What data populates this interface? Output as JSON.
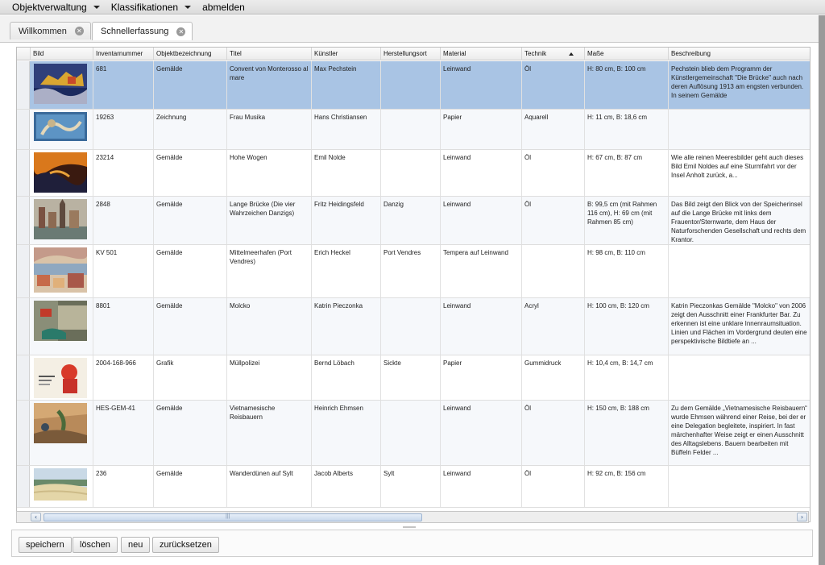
{
  "menu": {
    "items": [
      {
        "label": "Objektverwaltung",
        "has_dropdown": true
      },
      {
        "label": "Klassifikationen",
        "has_dropdown": true
      },
      {
        "label": "abmelden",
        "has_dropdown": false
      }
    ]
  },
  "tabs": [
    {
      "label": "Willkommen",
      "active": false
    },
    {
      "label": "Schnellerfassung",
      "active": true
    }
  ],
  "grid": {
    "columns": [
      "Bild",
      "Inventarnummer",
      "Objektbezeichnung",
      "Titel",
      "Künstler",
      "Herstellungsort",
      "Material",
      "Technik",
      "Maße",
      "Beschreibung"
    ],
    "sorted_column": "Technik",
    "sort_direction": "ascending",
    "rows": [
      {
        "inv": "681",
        "obj": "Gemälde",
        "titel": "Convent von Monterosso al mare",
        "kuenstler": "Max Pechstein",
        "ort": "",
        "material": "Leinwand",
        "technik": "Öl",
        "masse": "H: 80 cm, B: 100 cm",
        "beschreibung": "Pechstein blieb dem Programm der Künstlergemeinschaft \"Die Brücke\" auch nach deren Auflösung 1913 am engsten verbunden. In seinem Gemälde",
        "selected": true
      },
      {
        "inv": "19263",
        "obj": "Zeichnung",
        "titel": "Frau Musika",
        "kuenstler": "Hans Christiansen",
        "ort": "",
        "material": "Papier",
        "technik": "Aquarell",
        "masse": "H: 11 cm, B: 18,6 cm",
        "beschreibung": "",
        "selected": false
      },
      {
        "inv": "23214",
        "obj": "Gemälde",
        "titel": "Hohe Wogen",
        "kuenstler": "Emil Nolde",
        "ort": "",
        "material": "Leinwand",
        "technik": "Öl",
        "masse": "H: 67 cm, B: 87 cm",
        "beschreibung": "Wie alle reinen Meeresbilder geht auch dieses Bild Emil Noldes auf eine Sturmfahrt vor der Insel Anholt zurück, a...",
        "selected": false
      },
      {
        "inv": "2848",
        "obj": "Gemälde",
        "titel": "Lange Brücke (Die vier Wahrzeichen Danzigs)",
        "kuenstler": "Fritz Heidingsfeld",
        "ort": "Danzig",
        "material": "Leinwand",
        "technik": "Öl",
        "masse": "B: 99,5 cm (mit Rahmen 116 cm), H: 69 cm (mit Rahmen 85 cm)",
        "beschreibung": "Das Bild zeigt den Blick von der Speicherinsel auf die Lange Brücke mit links dem Frauentor/Sternwarte, dem Haus der Naturforschenden Gesellschaft und rechts dem Krantor.",
        "selected": false
      },
      {
        "inv": "KV 501",
        "obj": "Gemälde",
        "titel": "Mittelmeerhafen (Port Vendres)",
        "kuenstler": "Erich Heckel",
        "ort": "Port Vendres",
        "material": "Tempera auf Leinwand",
        "technik": "",
        "masse": "H: 98 cm, B: 110 cm",
        "beschreibung": "",
        "selected": false
      },
      {
        "inv": "8801",
        "obj": "Gemälde",
        "titel": "Molcko",
        "kuenstler": "Katrin Pieczonka",
        "ort": "",
        "material": "Leinwand",
        "technik": "Acryl",
        "masse": "H: 100 cm, B: 120 cm",
        "beschreibung": "Katrin Pieczonkas Gemälde \"Molcko\" von 2006 zeigt den Ausschnitt einer Frankfurter Bar. Zu erkennen ist eine unklare Innenraumsituation. Linien und Flächen im Vordergrund deuten eine perspektivische Bildtiefe an ...",
        "selected": false
      },
      {
        "inv": "2004-168-966",
        "obj": "Grafik",
        "titel": "Müllpolizei",
        "kuenstler": "Bernd Löbach",
        "ort": "Sickte",
        "material": "Papier",
        "technik": "Gummidruck",
        "masse": "H: 10,4 cm, B: 14,7 cm",
        "beschreibung": "",
        "selected": false
      },
      {
        "inv": "HES-GEM-41",
        "obj": "Gemälde",
        "titel": "Vietnamesische Reisbauern",
        "kuenstler": "Heinrich Ehmsen",
        "ort": "",
        "material": "Leinwand",
        "technik": "Öl",
        "masse": "H: 150 cm, B: 188 cm",
        "beschreibung": "Zu dem Gemälde „Vietnamesische Reisbauern“ wurde Ehmsen während einer Reise, bei der er eine Delegation begleitete, inspiriert. In fast märchenhafter Weise zeigt er einen Ausschnitt des Alltagslebens. Bauern bearbeiten mit Büffeln Felder ...",
        "selected": false
      },
      {
        "inv": "236",
        "obj": "Gemälde",
        "titel": "Wanderdünen auf Sylt",
        "kuenstler": "Jacob Alberts",
        "ort": "Sylt",
        "material": "Leinwand",
        "technik": "Öl",
        "masse": "H: 92 cm, B: 156 cm",
        "beschreibung": "",
        "selected": false
      }
    ]
  },
  "scrollbar": {
    "left_arrow": "‹",
    "right_arrow": "›",
    "grip": "|||"
  },
  "buttons": {
    "save": "speichern",
    "delete": "löschen",
    "new": "neu",
    "reset": "zurücksetzen"
  },
  "colors": {
    "selection": "#a9c4e4",
    "menubar": "#e4e4e4",
    "scroll_thumb": "#c8d8ec"
  }
}
